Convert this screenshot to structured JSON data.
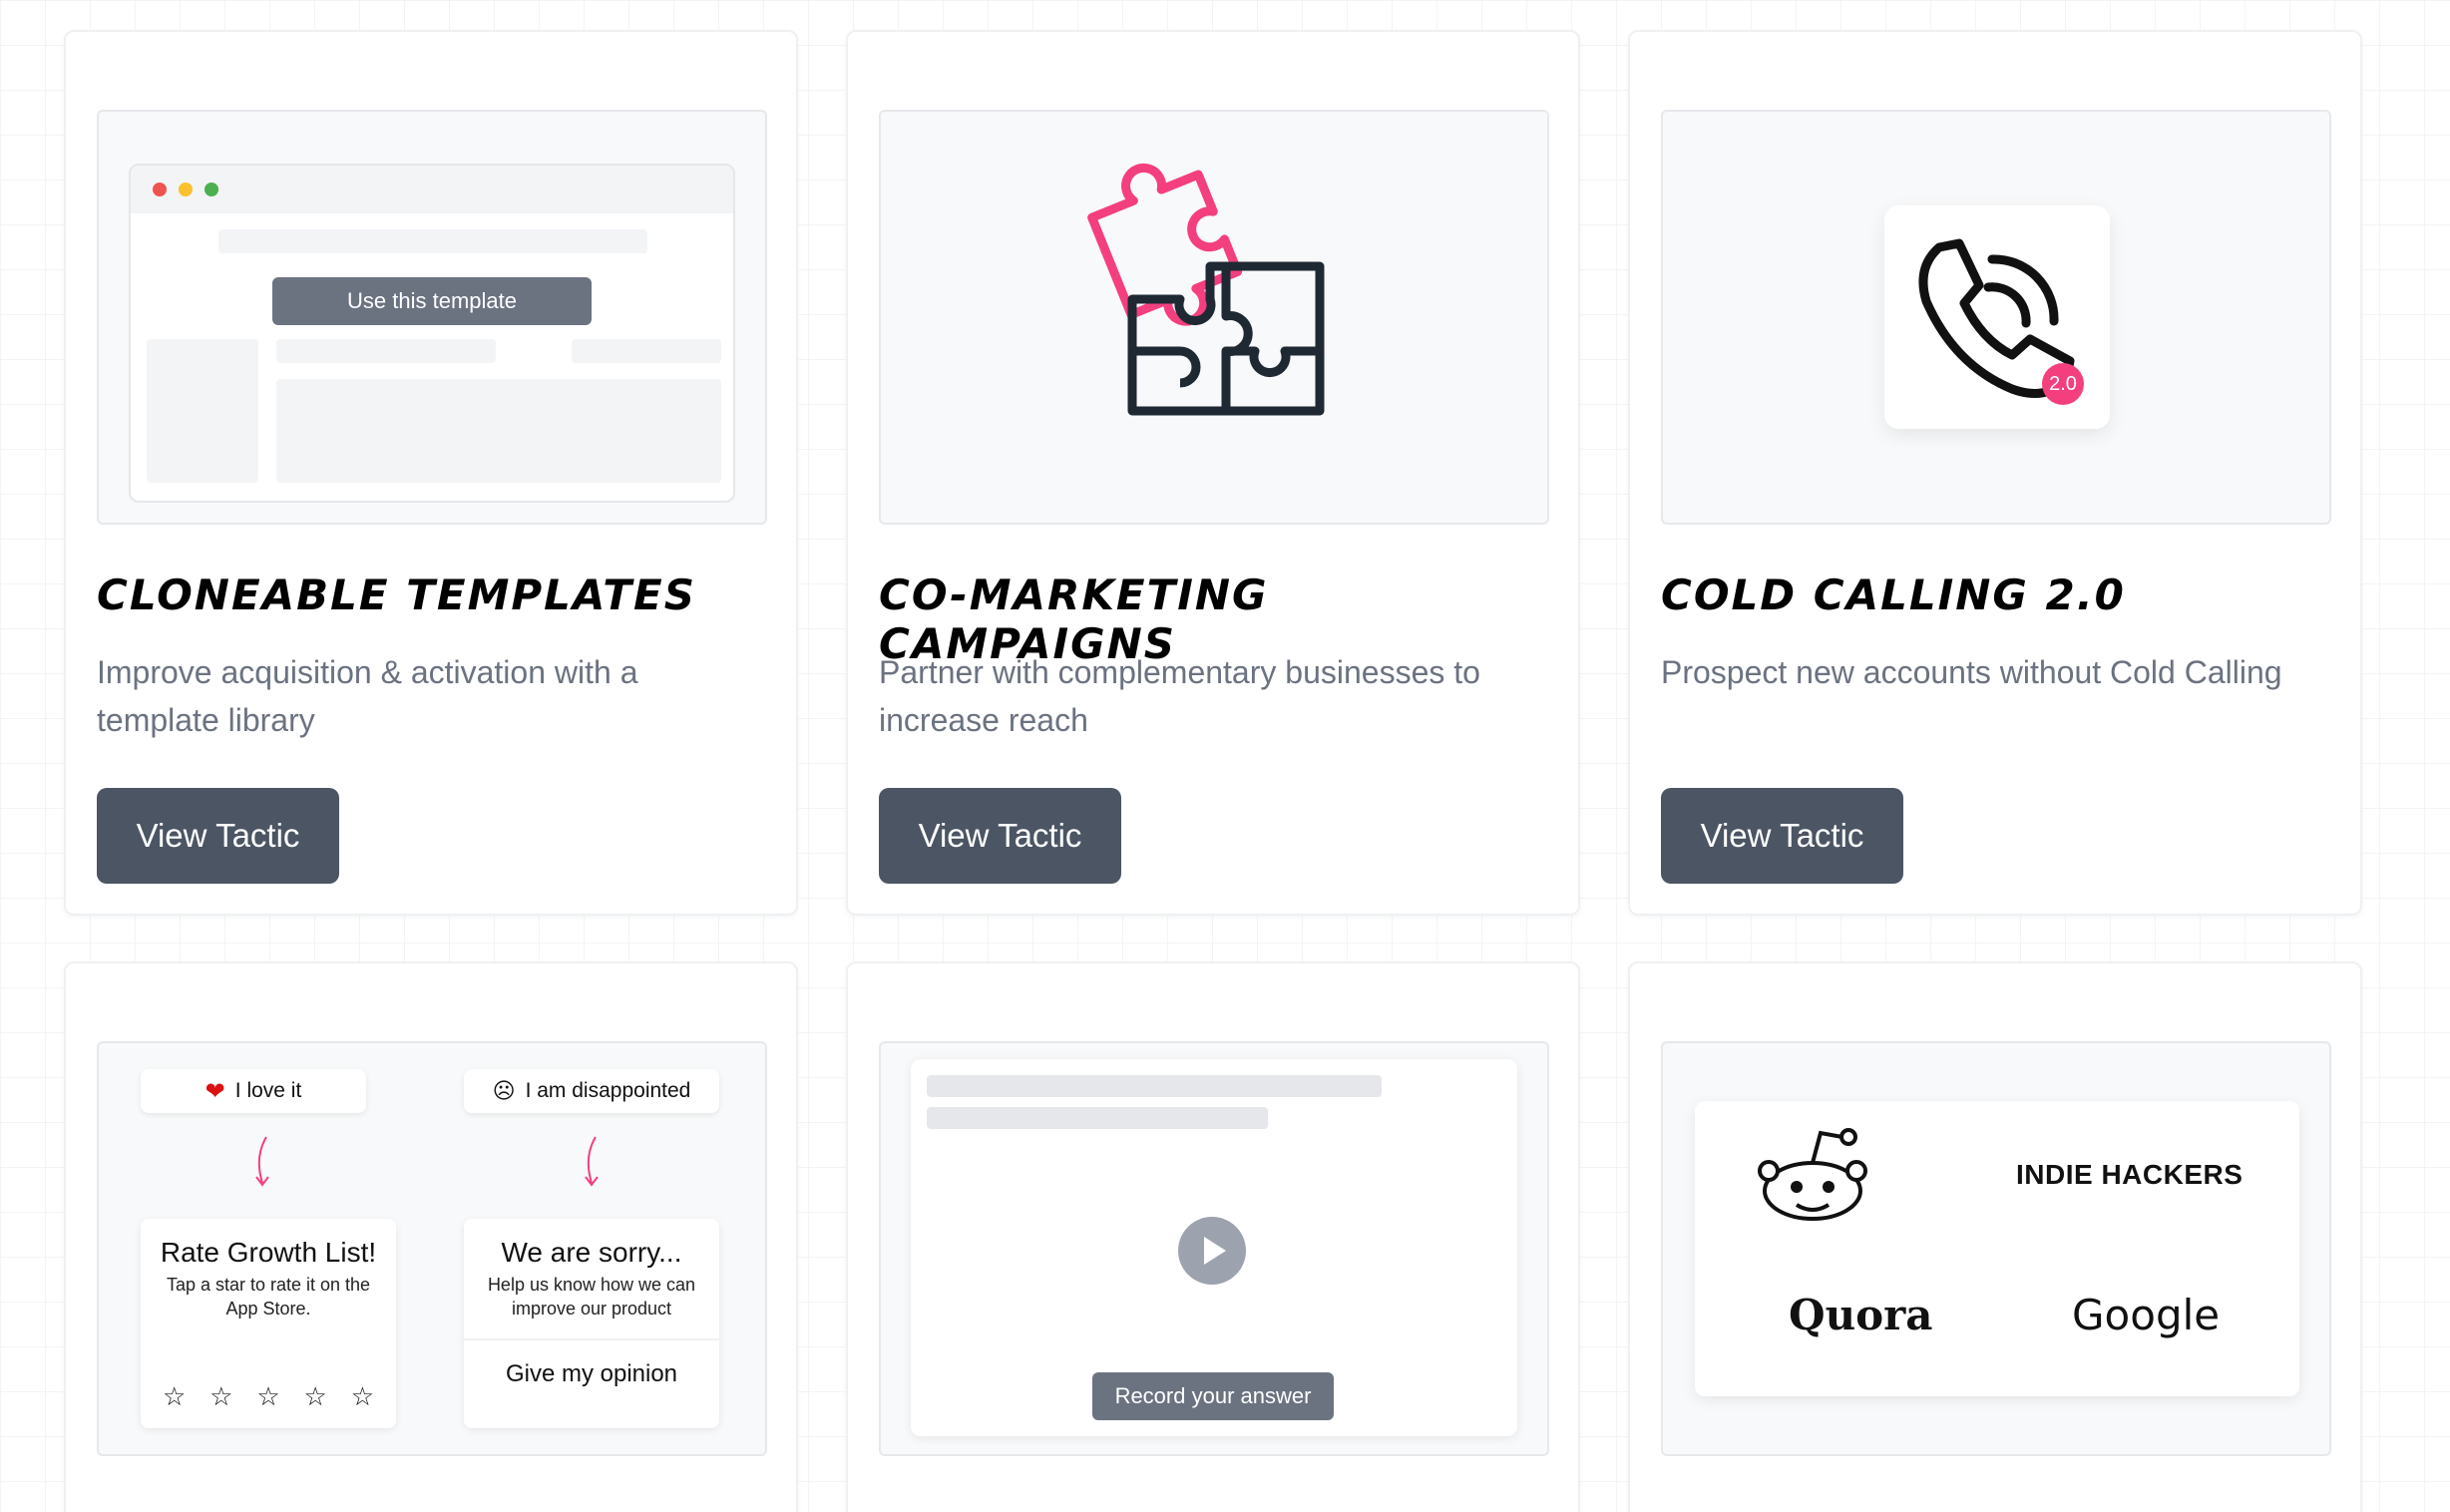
{
  "cards": [
    {
      "title": "Cloneable Templates",
      "description": "Improve acquisition & activation with a template library",
      "button": "View Tactic",
      "preview": {
        "cta": "Use this template"
      }
    },
    {
      "title": "Co-Marketing Campaigns",
      "description": "Partner with complementary businesses to increase reach",
      "button": "View Tactic"
    },
    {
      "title": "Cold Calling 2.0",
      "description": "Prospect new accounts without Cold Calling",
      "button": "View Tactic",
      "preview": {
        "badge": "2.0"
      }
    }
  ],
  "rating_preview": {
    "positive_label": "I love it",
    "negative_label": "I am disappointed",
    "positive_card": {
      "title": "Rate Growth List!",
      "subtitle": "Tap a star to rate it on the App Store."
    },
    "negative_card": {
      "title": "We are sorry...",
      "subtitle": "Help us know how we can improve our product",
      "action": "Give my opinion"
    }
  },
  "record_preview": {
    "button": "Record your answer"
  },
  "communities_preview": {
    "logos": [
      "INDIE HACKERS",
      "Quora",
      "Google"
    ],
    "reddit_icon": "reddit-icon"
  },
  "colors": {
    "accent_pink": "#f43f7f",
    "button_dark": "#4b5563",
    "text_muted": "#6b7280"
  }
}
